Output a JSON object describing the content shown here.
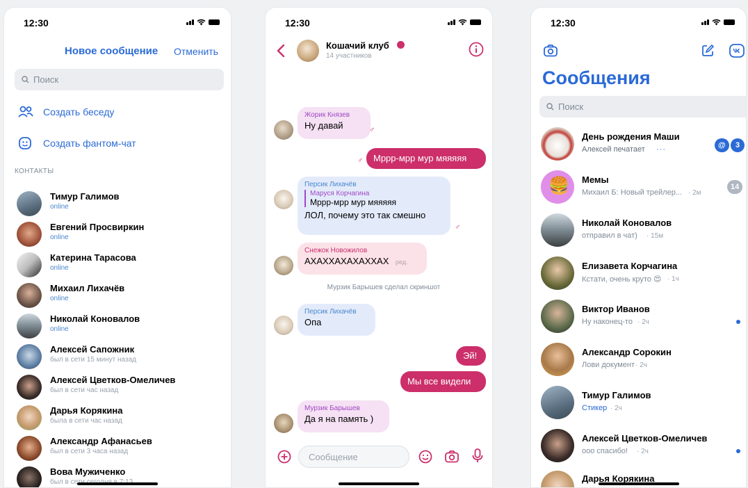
{
  "status": {
    "time": "12:30"
  },
  "contacts_screen": {
    "title": "Новое сообщение",
    "cancel": "Отменить",
    "search_placeholder": "Поиск",
    "actions": [
      "Создать беседу",
      "Создать фантом-чат"
    ],
    "section": "КОНТАКТЫ",
    "contacts": [
      {
        "name": "Тимур Галимов",
        "status": "online",
        "online": true
      },
      {
        "name": "Евгений Просвиркин",
        "status": "online",
        "online": true
      },
      {
        "name": "Катерина Тарасова",
        "status": "online",
        "online": true
      },
      {
        "name": "Михаил Лихачёв",
        "status": "online",
        "online": true
      },
      {
        "name": "Николай Коновалов",
        "status": "online",
        "online": true
      },
      {
        "name": "Алексей Сапожник",
        "status": "был в сети 15 минут назад",
        "online": false
      },
      {
        "name": "Алексей Цветков-Омеличев",
        "status": "был в сети час назад",
        "online": false
      },
      {
        "name": "Дарья Корякина",
        "status": "была в сети час назад",
        "online": false
      },
      {
        "name": "Александр Афанасьев",
        "status": "был в сети 3 часа назад",
        "online": false
      },
      {
        "name": "Вова Мужиченко",
        "status": "был в сети сегодня в 7:13",
        "online": false
      }
    ]
  },
  "chat_screen": {
    "title": "Кошачий клуб",
    "members": "14 участников",
    "messages": {
      "m1_sender": "Жорик Князев",
      "m1_text": "Ну давай",
      "m2_text": "Мррр-мрр мур мяяяяя",
      "m3_sender": "Персик Лихачёв",
      "m3_reply_author": "Маруся Корчагина",
      "m3_reply_text": "Мррр-мрр мур мяяяяя",
      "m3_text": "ЛОЛ, почему это так смешно",
      "m4_sender": "Снежок Новожилов",
      "m4_text": "АХАХХАХАХАХХАХ",
      "m4_edited": "ред.",
      "service": "Мурзик Барышев сделал скриншот",
      "m5_sender": "Персик Лихачёв",
      "m5_text": "Опа",
      "m6_text": "Эй!",
      "m7_text": "Мы все видели",
      "m8_sender": "Мурзик Барышев",
      "m8_text": "Да я на память )"
    },
    "composer_placeholder": "Сообщение"
  },
  "messages_screen": {
    "title": "Сообщения",
    "search_placeholder": "Поиск",
    "chats": [
      {
        "name": "День рождения Маши",
        "preview": "Алексей печатает",
        "time": "",
        "mention": "@",
        "unread": "3"
      },
      {
        "name": "Мемы",
        "preview": "Михаил Б: Новый трейлер...",
        "time": "· 2м",
        "unread": "14"
      },
      {
        "name": "Николай Коновалов",
        "preview": "отправил в чат)",
        "time": "· 15м"
      },
      {
        "name": "Елизавета Корчагина",
        "preview": "Кстати, очень круто 😍",
        "time": "· 1ч"
      },
      {
        "name": "Виктор Иванов",
        "preview": "Ну наконец-то",
        "time": "· 2ч"
      },
      {
        "name": "Александр Сорокин",
        "preview": "Лови документ",
        "time": "· 2ч"
      },
      {
        "name": "Тимур Галимов",
        "preview": "Стикер",
        "time": "· 2ч"
      },
      {
        "name": "Алексей Цветков-Омеличев",
        "preview": "ооо спасибо!",
        "time": "· 2ч"
      },
      {
        "name": "Дарья Корякина",
        "preview": "",
        "time": ""
      }
    ]
  },
  "colors": {
    "accent": "#2b6ad6",
    "chat_accent": "#cc2f6a"
  }
}
